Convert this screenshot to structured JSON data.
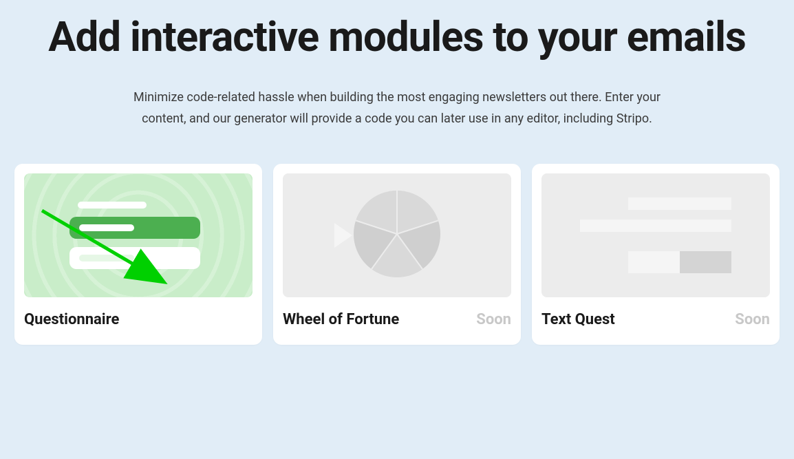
{
  "heading": "Add interactive modules to your emails",
  "subheading": "Minimize code-related hassle when building the most engaging newsletters out there. Enter your content, and our generator will provide a code you can later use in any editor, including Stripo.",
  "cards": [
    {
      "title": "Questionnaire",
      "badge": "",
      "available": true
    },
    {
      "title": "Wheel of Fortune",
      "badge": "Soon",
      "available": false
    },
    {
      "title": "Text Quest",
      "badge": "Soon",
      "available": false
    }
  ],
  "colors": {
    "background": "#e1edf7",
    "accent_green": "#4caf50",
    "text": "#1a1a1a",
    "badge": "#c8c8c8"
  }
}
